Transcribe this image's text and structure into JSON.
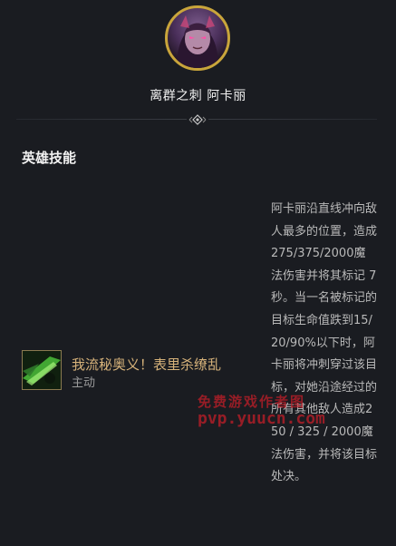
{
  "champion": {
    "title": "离群之刺 阿卡丽",
    "portrait_icon": "champion-portrait",
    "ring_color": "#c9a53b"
  },
  "section": {
    "heading": "英雄技能"
  },
  "skill": {
    "icon": "ultimate-skill-icon",
    "name": "我流秘奥义！表里杀缭乱",
    "type": "主动",
    "name_color": "#d6b27a",
    "description": "阿卡丽沿直线冲向敌人最多的位置，造成275/375/2000魔法伤害并将其标记 7 秒。当一名被标记的目标生命值跌到15/20/90%以下时，阿卡丽将冲刺穿过该目标，对她沿途经过的所有其他敌人造成250 / 325 / 2000魔法伤害，并将该目标处决。"
  },
  "watermark": {
    "line1": "免费游戏作者图",
    "line2": "pvp.yuucn.com"
  }
}
